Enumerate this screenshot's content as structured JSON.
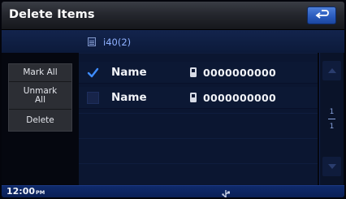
{
  "window": {
    "title": "Delete Items"
  },
  "folder": {
    "label": "i40(2)",
    "icon": "contact-list-icon"
  },
  "commands": [
    {
      "label": "Mark All"
    },
    {
      "label": "Unmark All"
    },
    {
      "label": "Delete"
    }
  ],
  "items": [
    {
      "name": "Name",
      "number": "0000000000",
      "checked": true,
      "icon": "phone-icon"
    },
    {
      "name": "Name",
      "number": "0000000000",
      "checked": false,
      "icon": "phone-icon"
    }
  ],
  "pagination": {
    "current": "1",
    "total": "1"
  },
  "status": {
    "time": "12:00",
    "ampm": "PM"
  },
  "colors": {
    "accent": "#2b5cbe",
    "list_background": "#0c1834",
    "status_bar": "#0f2a6b",
    "folder_text": "#8fb1ff"
  }
}
